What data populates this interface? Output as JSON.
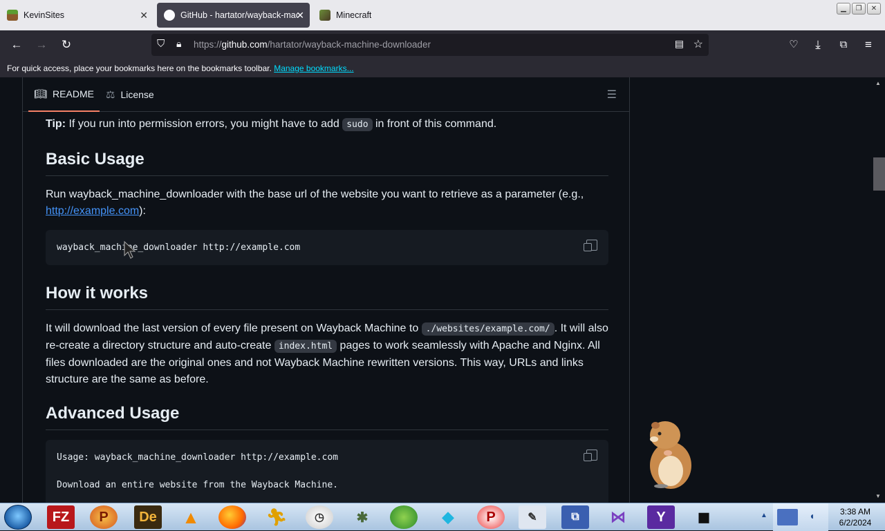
{
  "tabs": [
    {
      "title": "KevinSites",
      "favicon": "minecraft-grass-icon"
    },
    {
      "title": "GitHub - hartator/wayback-machine-downloader",
      "favicon": "github-icon",
      "active": true
    },
    {
      "title": "Minecraft",
      "favicon": "minecraft-block-icon"
    }
  ],
  "url": {
    "scheme": "https://",
    "host": "github.com",
    "path": "/hartator/wayback-machine-downloader"
  },
  "bookmarks": {
    "text": "For quick access, place your bookmarks here on the bookmarks toolbar.",
    "manage": "Manage bookmarks..."
  },
  "readme_tabs": {
    "readme": "README",
    "license": "License"
  },
  "tip": {
    "label": "Tip:",
    "before": " If you run into permission errors, you might have to add ",
    "code": "sudo",
    "after": " in front of this command."
  },
  "basic": {
    "heading": "Basic Usage",
    "text": "Run wayback_machine_downloader with the base url of the website you want to retrieve as a parameter (e.g., ",
    "link": "http://example.com",
    "text_end": "):",
    "code": "wayback_machine_downloader http://example.com"
  },
  "how": {
    "heading": "How it works",
    "t1": "It will download the last version of every file present on Wayback Machine to ",
    "c1": "./websites/example.com/",
    "t2": ". It will also re-create a directory structure and auto-create ",
    "c2": "index.html",
    "t3": " pages to work seamlessly with Apache and Nginx. All files downloaded are the original ones and not Wayback Machine rewritten versions. This way, URLs and links structure are the same as before."
  },
  "advanced": {
    "heading": "Advanced Usage",
    "line1": "Usage: wayback_machine_downloader http://example.com",
    "line2": "Download an entire website from the Wayback Machine."
  },
  "clock": {
    "time": "3:38 AM",
    "date": "6/2/2024"
  },
  "colors": {
    "accent": "#f78166",
    "link": "#4493f8",
    "page_bg": "#0d1117"
  }
}
